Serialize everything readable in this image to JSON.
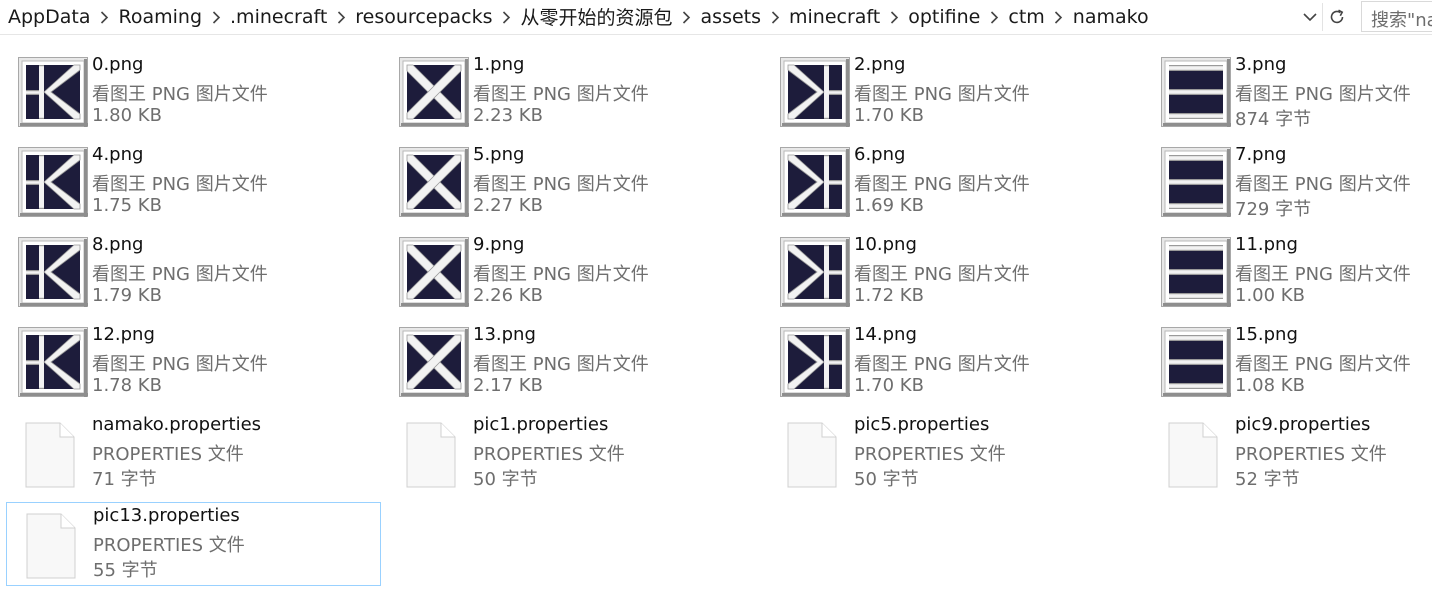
{
  "breadcrumb": [
    "AppData",
    "Roaming",
    ".minecraft",
    "resourcepacks",
    "从零开始的资源包",
    "assets",
    "minecraft",
    "optifine",
    "ctm",
    "namako"
  ],
  "search": {
    "placeholder": "搜索\"na"
  },
  "icons": {
    "separator": "chevron-right-icon",
    "dropdown": "chevron-down-icon",
    "refresh": "refresh-icon",
    "document": "document-icon"
  },
  "colors": {
    "tile_dark": "#1d1c3b",
    "tile_frame": "#e6e6e6",
    "selection_border": "#99d1ff",
    "secondary_text": "#6e6e6e"
  },
  "files": [
    {
      "name": "0.png",
      "type": "看图王 PNG 图片文件",
      "size": "1.80 KB",
      "thumb": "k"
    },
    {
      "name": "1.png",
      "type": "看图王 PNG 图片文件",
      "size": "2.23 KB",
      "thumb": "x"
    },
    {
      "name": "2.png",
      "type": "看图王 PNG 图片文件",
      "size": "1.70 KB",
      "thumb": "rk"
    },
    {
      "name": "3.png",
      "type": "看图王 PNG 图片文件",
      "size": "874 字节",
      "thumb": "h"
    },
    {
      "name": "4.png",
      "type": "看图王 PNG 图片文件",
      "size": "1.75 KB",
      "thumb": "k"
    },
    {
      "name": "5.png",
      "type": "看图王 PNG 图片文件",
      "size": "2.27 KB",
      "thumb": "x"
    },
    {
      "name": "6.png",
      "type": "看图王 PNG 图片文件",
      "size": "1.69 KB",
      "thumb": "rk"
    },
    {
      "name": "7.png",
      "type": "看图王 PNG 图片文件",
      "size": "729 字节",
      "thumb": "h"
    },
    {
      "name": "8.png",
      "type": "看图王 PNG 图片文件",
      "size": "1.79 KB",
      "thumb": "k"
    },
    {
      "name": "9.png",
      "type": "看图王 PNG 图片文件",
      "size": "2.26 KB",
      "thumb": "x"
    },
    {
      "name": "10.png",
      "type": "看图王 PNG 图片文件",
      "size": "1.72 KB",
      "thumb": "rk"
    },
    {
      "name": "11.png",
      "type": "看图王 PNG 图片文件",
      "size": "1.00 KB",
      "thumb": "h"
    },
    {
      "name": "12.png",
      "type": "看图王 PNG 图片文件",
      "size": "1.78 KB",
      "thumb": "k"
    },
    {
      "name": "13.png",
      "type": "看图王 PNG 图片文件",
      "size": "2.17 KB",
      "thumb": "x"
    },
    {
      "name": "14.png",
      "type": "看图王 PNG 图片文件",
      "size": "1.70 KB",
      "thumb": "rk"
    },
    {
      "name": "15.png",
      "type": "看图王 PNG 图片文件",
      "size": "1.08 KB",
      "thumb": "h"
    },
    {
      "name": "namako.properties",
      "type": "PROPERTIES 文件",
      "size": "71 字节",
      "thumb": "doc"
    },
    {
      "name": "pic1.properties",
      "type": "PROPERTIES 文件",
      "size": "50 字节",
      "thumb": "doc"
    },
    {
      "name": "pic5.properties",
      "type": "PROPERTIES 文件",
      "size": "50 字节",
      "thumb": "doc"
    },
    {
      "name": "pic9.properties",
      "type": "PROPERTIES 文件",
      "size": "52 字节",
      "thumb": "doc"
    },
    {
      "name": "pic13.properties",
      "type": "PROPERTIES 文件",
      "size": "55 字节",
      "thumb": "doc",
      "selected": true
    }
  ]
}
